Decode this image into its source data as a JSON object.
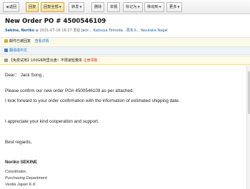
{
  "toolbar": {
    "back": "返回",
    "reply": "回复",
    "reply_all": "回复全部",
    "forward": "转发",
    "delete": "删除",
    "report": "举报",
    "mark_as": "标记为",
    "move_to": "移动到",
    "more": "更多"
  },
  "message": {
    "subject": "New Order PO # 4500546109",
    "sender": "Sekine, Noriko",
    "time": "2021-07-16 16:27",
    "to_label": "发给",
    "recipients": "Jack 、Katsuya Tomoda、周本ル、Yasutaka Nagai"
  },
  "info_bars": {
    "read_receipt": "邮件已被回复",
    "view_details": "查看详情",
    "translate": "翻译成中文",
    "ad_text": "【免费试用】100GB阿里云盘！不限速轻量体",
    "ad_link": "注册领取"
  },
  "body": {
    "greeting": "Dear： Jack Song ,",
    "line1": "Please confirm our new order PO# 4500546109 as per attached.",
    "line2": "I look forward to your order confirmation with the information of estimated shipping date.",
    "line3": "I appreciate your kind cooperation and support.",
    "line4": "Best regards,",
    "sig_name": "Noriko SEKINE",
    "sig_title": "Coordinator,",
    "sig_dept": "Purchasing Department",
    "sig_company": "Veolia Japan K.K."
  }
}
